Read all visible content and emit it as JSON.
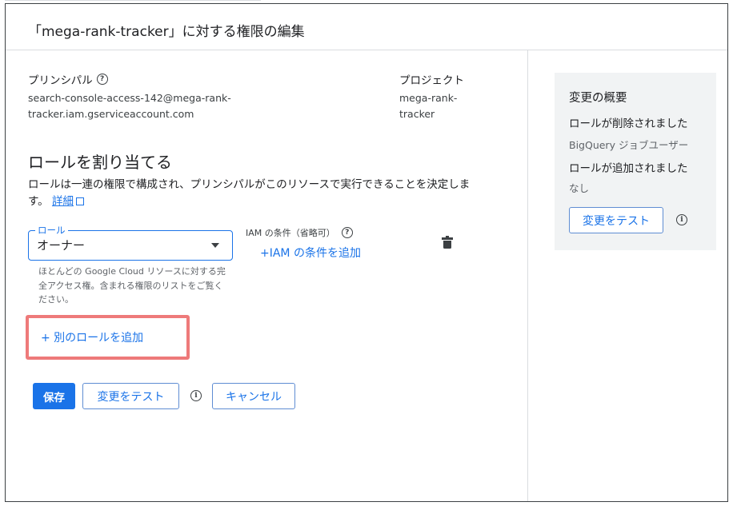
{
  "dialog": {
    "title": "「mega-rank-tracker」に対する権限の編集"
  },
  "principal": {
    "label": "プリンシパル",
    "value": "search-console-access-142@mega-rank-tracker.iam.gserviceaccount.com"
  },
  "project": {
    "label": "プロジェクト",
    "value": "mega-rank-tracker"
  },
  "roles": {
    "section_title": "ロールを割り当てる",
    "description": "ロールは一連の権限で構成され、プリンシパルがこのリソースで実行できることを決定します。",
    "details_link": "詳細",
    "role_field_label": "ロール",
    "role_value": "オーナー",
    "role_help": "ほとんどの Google Cloud リソースに対する完全アクセス権。含まれる権限のリストをご覧ください。",
    "iam_condition_label": "IAM の条件（省略可）",
    "iam_condition_add": "+IAM の条件を追加",
    "add_another_role": "+ 別のロールを追加"
  },
  "actions": {
    "save": "保存",
    "test_changes": "変更をテスト",
    "cancel": "キャンセル"
  },
  "summary": {
    "title": "変更の概要",
    "removed_label": "ロールが削除されました",
    "removed_value": "BigQuery ジョブユーザー",
    "added_label": "ロールが追加されました",
    "added_value": "なし",
    "test_changes": "変更をテスト"
  },
  "colors": {
    "accent": "#1a73e8",
    "highlight": "#ee7a7a",
    "panel_bg": "#f1f3f4"
  },
  "icons": {
    "help": "help-circle-icon",
    "info": "info-circle-icon",
    "dropdown": "caret-down-icon",
    "delete": "trash-icon",
    "external": "open-in-new-icon"
  }
}
